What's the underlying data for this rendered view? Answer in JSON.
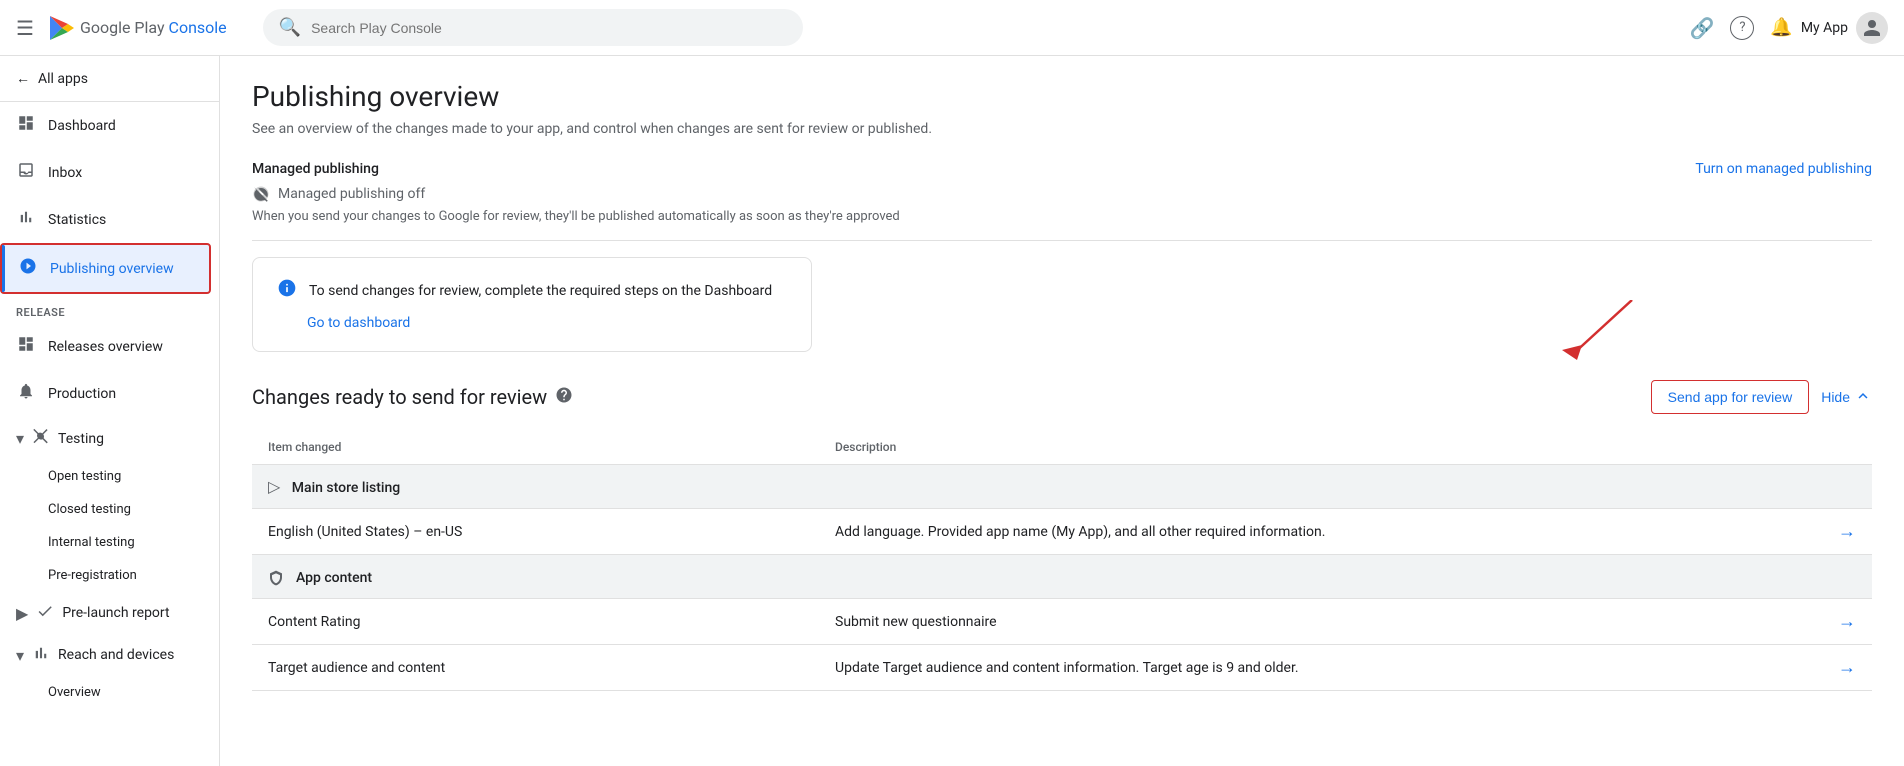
{
  "topbar": {
    "search_placeholder": "Search Play Console",
    "app_name": "My App",
    "link_icon": "🔗",
    "help_icon": "?",
    "profile_icon": "👤"
  },
  "logo": {
    "text_part1": "Google Play ",
    "text_part2": "Console"
  },
  "sidebar": {
    "all_apps_label": "All apps",
    "items": [
      {
        "id": "dashboard",
        "label": "Dashboard",
        "icon": "⊞"
      },
      {
        "id": "inbox",
        "label": "Inbox",
        "icon": "☐"
      },
      {
        "id": "statistics",
        "label": "Statistics",
        "icon": "📊"
      },
      {
        "id": "publishing-overview",
        "label": "Publishing overview",
        "icon": "⊡",
        "active": true
      }
    ],
    "release_section": "Release",
    "release_items": [
      {
        "id": "releases-overview",
        "label": "Releases overview",
        "icon": "⊞"
      },
      {
        "id": "production",
        "label": "Production",
        "icon": "🔔"
      }
    ],
    "testing_label": "Testing",
    "testing_sub_items": [
      {
        "id": "open-testing",
        "label": "Open testing"
      },
      {
        "id": "closed-testing",
        "label": "Closed testing"
      },
      {
        "id": "internal-testing",
        "label": "Internal testing"
      },
      {
        "id": "pre-registration",
        "label": "Pre-registration"
      }
    ],
    "pre_launch_label": "Pre-launch report",
    "reach_devices_label": "Reach and devices",
    "reach_sub_items": [
      {
        "id": "overview",
        "label": "Overview"
      }
    ]
  },
  "page": {
    "title": "Publishing overview",
    "subtitle": "See an overview of the changes made to your app, and control when changes are sent for review or published.",
    "managed_publishing_title": "Managed publishing",
    "managed_publishing_status": "Managed publishing off",
    "managed_publishing_desc": "When you send your changes to Google for review, they'll be published automatically as soon as they're approved",
    "turn_on_link": "Turn on managed publishing",
    "info_box_text": "To send changes for review, complete the required steps on the Dashboard",
    "go_dashboard_link": "Go to dashboard",
    "changes_title": "Changes ready to send for review",
    "send_review_btn": "Send app for review",
    "hide_btn": "Hide",
    "table_col1": "Item changed",
    "table_col2": "Description",
    "group1_label": "Main store listing",
    "group1_icon": "▷",
    "group2_label": "App content",
    "group2_icon": "🛡",
    "rows": [
      {
        "id": "en-us-row",
        "item": "English (United States) – en-US",
        "description": "Add language. Provided app name (My App), and all other required information.",
        "group": "store-listing"
      },
      {
        "id": "content-rating",
        "item": "Content Rating",
        "description": "Submit new questionnaire",
        "group": "app-content"
      },
      {
        "id": "target-audience",
        "item": "Target audience and content",
        "description": "Update Target audience and content information. Target age is 9 and older.",
        "group": "app-content"
      }
    ]
  }
}
